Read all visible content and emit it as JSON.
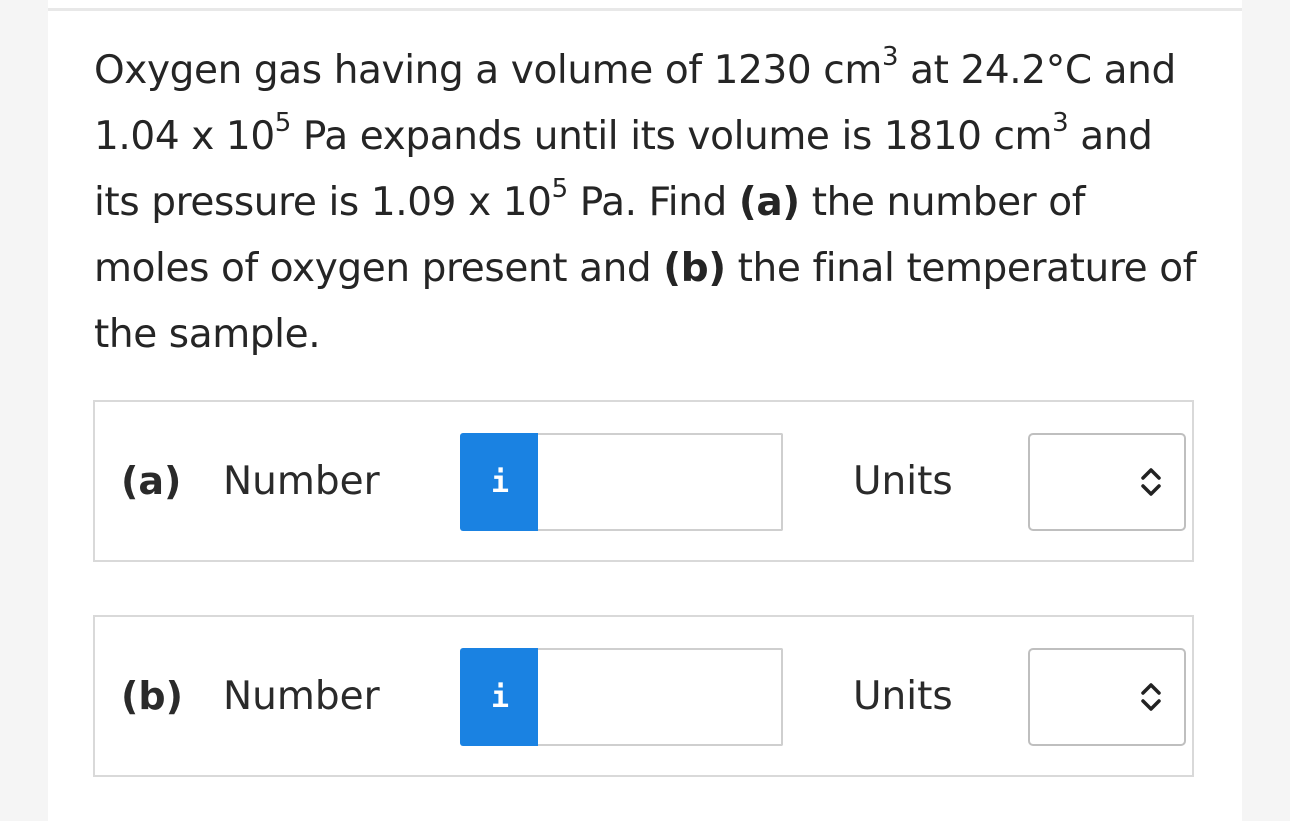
{
  "question": {
    "p1": "Oxygen gas having a volume of 1230 cm",
    "sup1": "3",
    "p2": " at 24.2°C and 1.04 x 10",
    "sup2": "5",
    "p3": " Pa expands until its volume is 1810 cm",
    "sup3": "3",
    "p4": " and its pressure is 1.09 x 10",
    "sup4": "5",
    "p5": " Pa. Find ",
    "bold_a": "(a)",
    "p6": " the number of moles of oxygen present and ",
    "bold_b": "(b)",
    "p7": " the final temperature of the sample."
  },
  "answers": [
    {
      "part_label": "(a)",
      "number_label": "Number",
      "info_icon": "i",
      "number_value": "",
      "units_label": "Units",
      "units_value": ""
    },
    {
      "part_label": "(b)",
      "number_label": "Number",
      "info_icon": "i",
      "number_value": "",
      "units_label": "Units",
      "units_value": ""
    }
  ],
  "colors": {
    "info_button": "#1a82e2",
    "border": "#d9d9d9"
  }
}
